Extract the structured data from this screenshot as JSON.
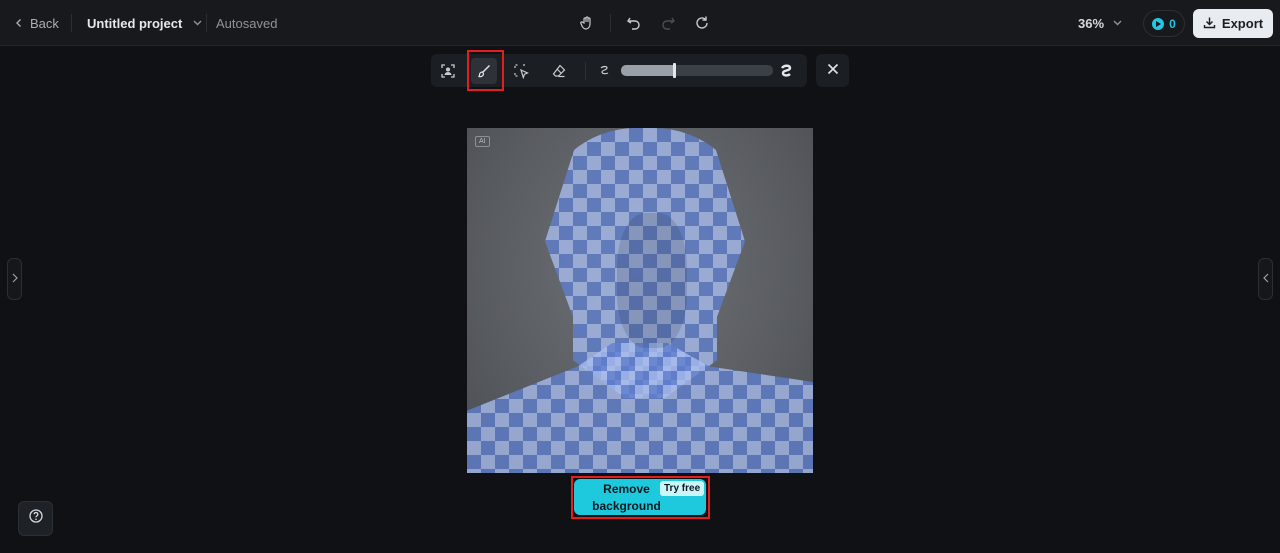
{
  "header": {
    "back_label": "Back",
    "project_name": "Untitled project",
    "save_status": "Autosaved",
    "zoom_level": "36%",
    "credits": "0",
    "export_label": "Export"
  },
  "toolbar": {
    "tools": [
      "person-select-icon",
      "brush-icon",
      "smart-select-icon",
      "eraser-icon"
    ],
    "active_tool": "brush-icon",
    "brush_size_level": 0.35
  },
  "canvas": {
    "ai_badge": "AI"
  },
  "action": {
    "remove_label_line1": "Remove",
    "remove_label_line2": "background",
    "badge": "Try free"
  },
  "colors": {
    "accent": "#1ec8dd",
    "highlight": "#e02020",
    "mask": "#5f7fd0"
  }
}
